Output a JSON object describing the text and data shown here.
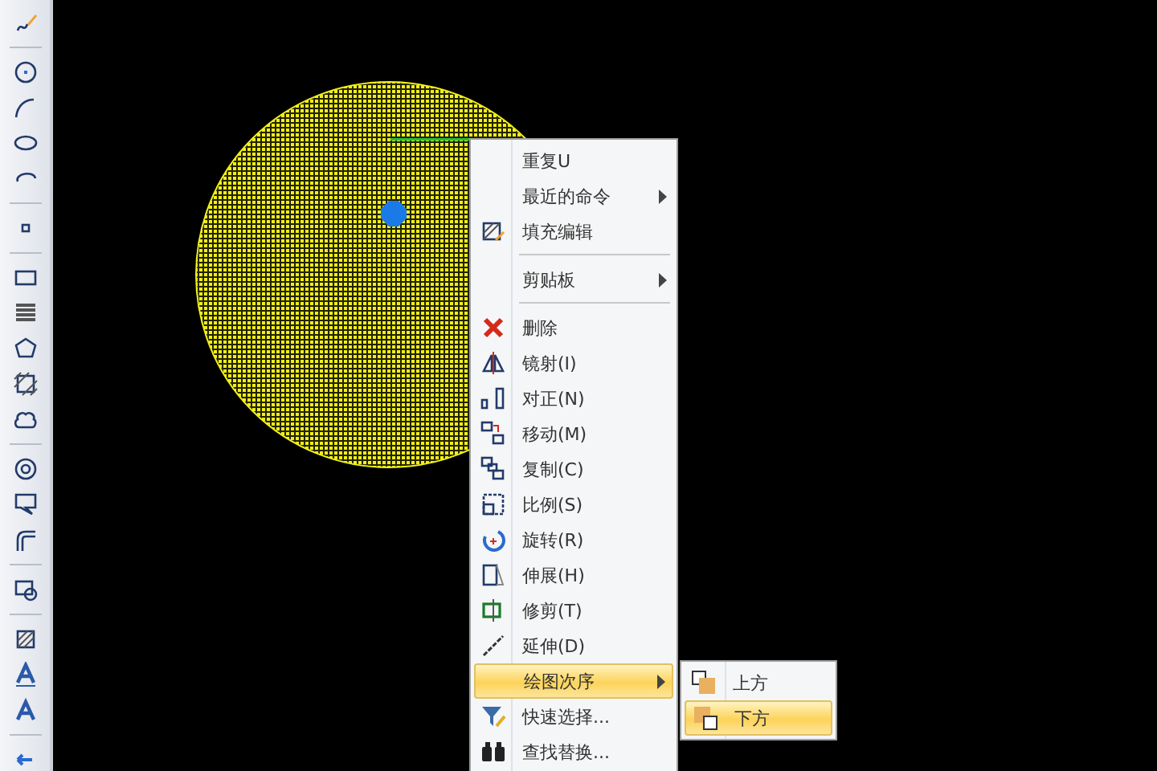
{
  "context_menu": {
    "items": [
      {
        "kind": "item",
        "label": "重复U",
        "submenu": false,
        "selected": false
      },
      {
        "kind": "item",
        "label": "最近的命令",
        "submenu": true,
        "selected": false
      },
      {
        "kind": "item",
        "label": "填充编辑",
        "submenu": false,
        "selected": false
      },
      {
        "kind": "separator"
      },
      {
        "kind": "item",
        "label": "剪贴板",
        "submenu": true,
        "selected": false
      },
      {
        "kind": "separator"
      },
      {
        "kind": "item",
        "label": "删除",
        "submenu": false,
        "selected": false
      },
      {
        "kind": "item",
        "label": "镜射(I)",
        "submenu": false,
        "selected": false
      },
      {
        "kind": "item",
        "label": "对正(N)",
        "submenu": false,
        "selected": false
      },
      {
        "kind": "item",
        "label": "移动(M)",
        "submenu": false,
        "selected": false
      },
      {
        "kind": "item",
        "label": "复制(C)",
        "submenu": false,
        "selected": false
      },
      {
        "kind": "item",
        "label": "比例(S)",
        "submenu": false,
        "selected": false
      },
      {
        "kind": "item",
        "label": "旋转(R)",
        "submenu": false,
        "selected": false
      },
      {
        "kind": "item",
        "label": "伸展(H)",
        "submenu": false,
        "selected": false
      },
      {
        "kind": "item",
        "label": "修剪(T)",
        "submenu": false,
        "selected": false
      },
      {
        "kind": "item",
        "label": "延伸(D)",
        "submenu": false,
        "selected": false
      },
      {
        "kind": "item",
        "label": "绘图次序",
        "submenu": true,
        "selected": true
      },
      {
        "kind": "item",
        "label": "快速选择...",
        "submenu": false,
        "selected": false
      },
      {
        "kind": "item",
        "label": "查找替换...",
        "submenu": false,
        "selected": false
      }
    ]
  },
  "submenu": {
    "items": [
      {
        "label": "上方",
        "selected": false
      },
      {
        "label": "下方",
        "selected": true
      }
    ]
  }
}
